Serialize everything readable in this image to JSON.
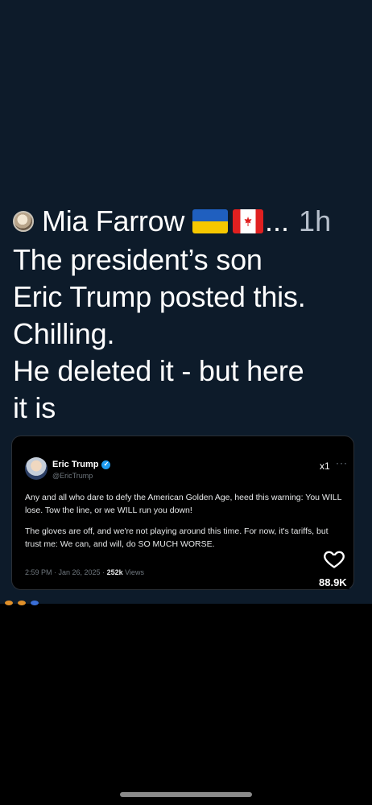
{
  "post": {
    "author": "Mia Farrow",
    "flags": [
      "ukraine-flag-icon",
      "canada-flag-icon"
    ],
    "ellipsis": "...",
    "time": "1h",
    "text": "The president’s son\nEric Trump posted this.\nChilling.\nHe deleted it - but here\nit is"
  },
  "embed": {
    "name": "Eric Trump",
    "handle": "@EricTrump",
    "x_label": "x1",
    "more": "···",
    "paragraph1": "Any and all who dare to defy the American Golden Age, heed this warning: You WILL lose. Tow the line, or we WILL run you down!",
    "paragraph2": "The gloves are off, and we're not playing around this time. For now, it's tariffs, but trust me: We can, and will, do SO MUCH WORSE.",
    "timestamp": "2:59 PM · Jan 26, 2025 · ",
    "views_count": "252k",
    "views_label": " Views"
  },
  "likes": "88.9K",
  "colors": {
    "background": "#0d1b2a",
    "embed_background": "#000000",
    "verified": "#1d9bf0"
  }
}
